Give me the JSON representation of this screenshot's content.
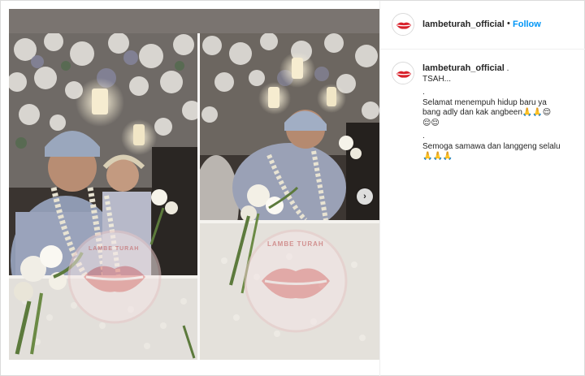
{
  "post": {
    "account": {
      "username": "lambeturah_official",
      "avatar_icon": "lips-logo-icon",
      "separator": "•",
      "follow_label": "Follow"
    },
    "caption": {
      "username": "lambeturah_official",
      "username_suffix": ".",
      "lines": [
        "TSAH...",
        ".",
        "Selamat menempuh hidup baru ya",
        "bang adly dan kak angbeen🙏🙏😌",
        "😌😌",
        ".",
        "Semoga samawa dan langgeng selalu",
        "🙏🙏🙏"
      ]
    },
    "media": {
      "next_icon": "chevron-right-icon",
      "watermark_text": "LAMBE TURAH",
      "watermark_icon": "lips-watermark-icon"
    },
    "colors": {
      "accent": "#0095f6",
      "text": "#262626",
      "border": "#dbdbdb",
      "logo_red": "#d8202a"
    }
  }
}
